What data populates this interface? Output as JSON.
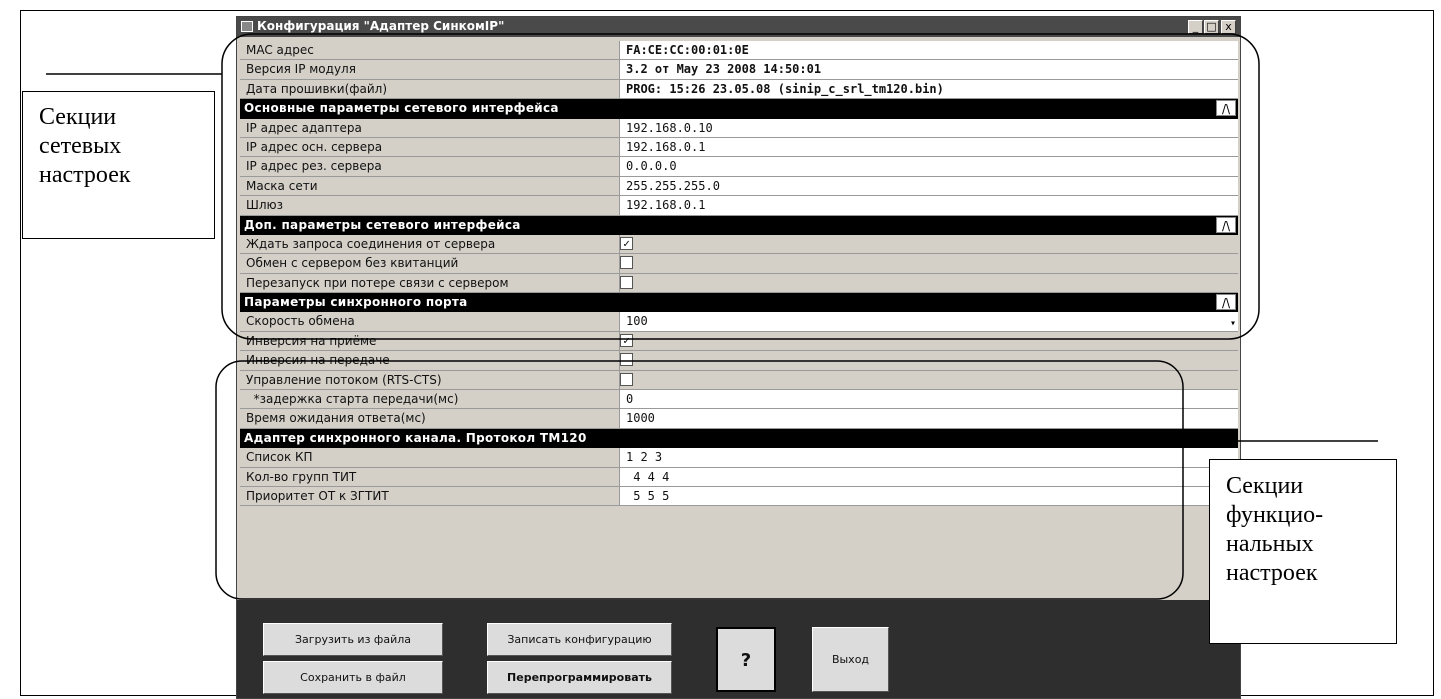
{
  "window": {
    "title": "Конфигурация \"Адаптер СинкомIP\"",
    "min_glyph": "_",
    "max_glyph": "□",
    "close_glyph": "x"
  },
  "info_rows": [
    {
      "label": "MAC адрес",
      "value": "FA:CE:CC:00:01:0E"
    },
    {
      "label": "Версия IP модуля",
      "value": " 3.2 от May 23 2008 14:50:01"
    },
    {
      "label": "Дата прошивки(файл)",
      "value": "PROG: 15:26 23.05.08 (sinip_c_srl_tm120.bin)"
    }
  ],
  "section_net_main": {
    "title": "Основные параметры сетевого интерфейса",
    "collapse_glyph": "/\\",
    "rows": [
      {
        "label": "IP адрес адаптера",
        "value": "192.168.0.10"
      },
      {
        "label": "IP адрес осн. сервера",
        "value": "192.168.0.1"
      },
      {
        "label": "IP адрес рез. сервера",
        "value": "0.0.0.0"
      },
      {
        "label": "Маска сети",
        "value": "255.255.255.0"
      },
      {
        "label": "Шлюз",
        "value": "192.168.0.1"
      }
    ]
  },
  "section_net_extra": {
    "title": "Доп. параметры сетевого интерфейса",
    "collapse_glyph": "/\\",
    "rows": [
      {
        "label": "Ждать запроса соединения от сервера",
        "checked": "✓"
      },
      {
        "label": "Обмен с сервером без квитанций",
        "checked": ""
      },
      {
        "label": "Перезапуск при потере связи с сервером",
        "checked": ""
      }
    ]
  },
  "section_sync": {
    "title": "Параметры синхронного порта",
    "collapse_glyph": "/\\",
    "rows": [
      {
        "label": "Скорость обмена",
        "value": "100",
        "dropdown_glyph": "▾"
      },
      {
        "label": "Инверсия на приёме",
        "checked": "✓"
      },
      {
        "label": "Инверсия на передаче",
        "checked": ""
      },
      {
        "label": "Управление потоком  (RTS-CTS)",
        "checked": ""
      },
      {
        "label": "  *задержка старта передачи(мс)",
        "value": "0"
      },
      {
        "label": "Время ожидания ответа(мс)",
        "value": "1000"
      }
    ]
  },
  "section_adapter": {
    "title": "Адаптер синхронного канала. Протокол ТМ120",
    "rows": [
      {
        "label": "Список КП",
        "value": "1 2 3"
      },
      {
        "label": "Кол-во групп ТИТ",
        "value": " 4 4 4"
      },
      {
        "label": "Приоритет ОТ к ЗГТИТ",
        "value": " 5 5 5"
      }
    ]
  },
  "buttons": {
    "load": "Загрузить из файла",
    "save": "Сохранить в файл",
    "write": "Записать конфигурацию",
    "reprogram": "Перепрограммировать",
    "help": "?",
    "exit": "Выход"
  },
  "annotations": {
    "network": [
      "Секции",
      "сетевых",
      "настроек"
    ],
    "functional": [
      "Секции",
      "функцио-",
      "нальных",
      "настроек"
    ]
  }
}
